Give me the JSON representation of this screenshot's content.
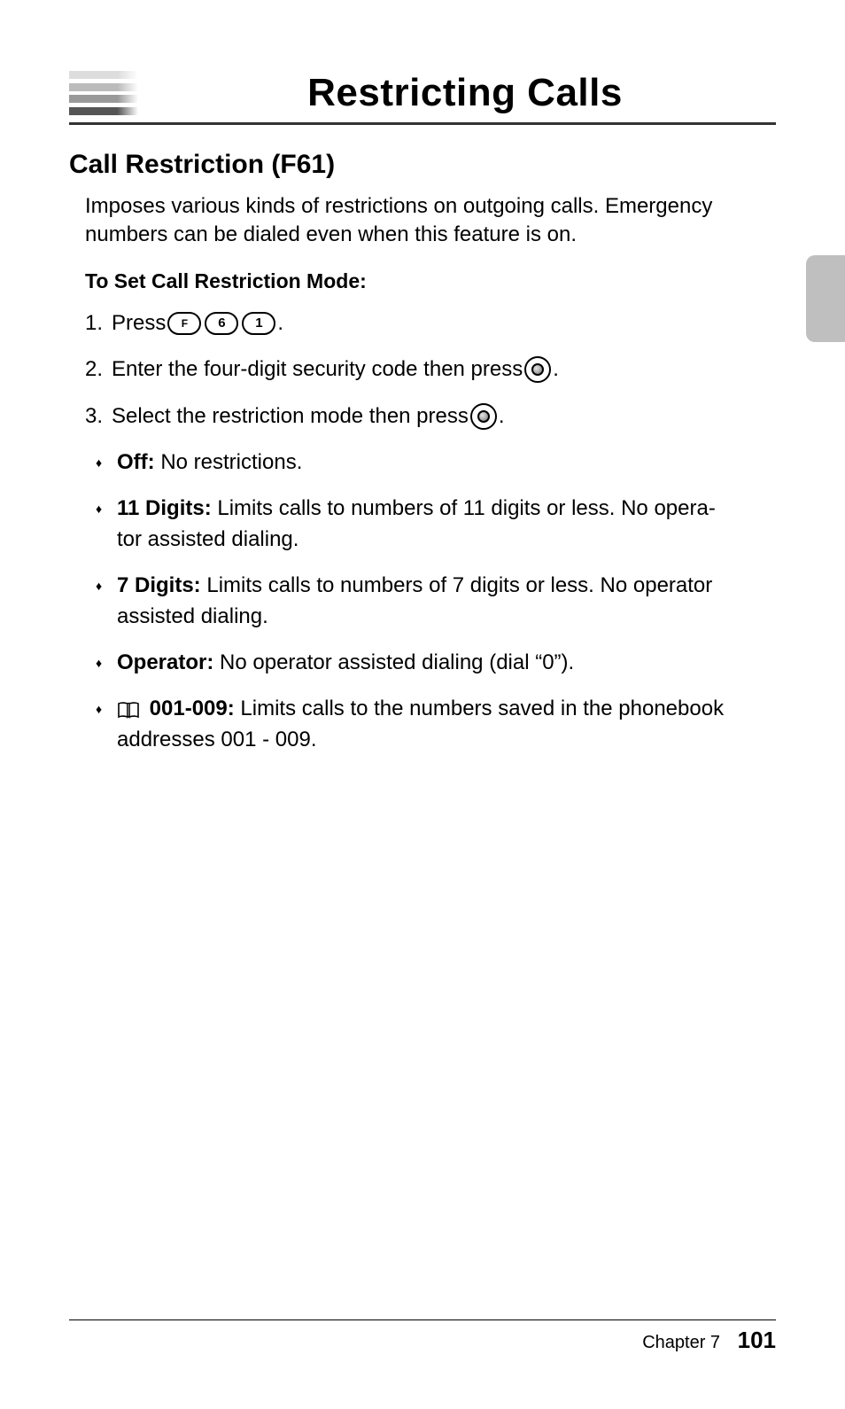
{
  "header": {
    "title": "Restricting Calls"
  },
  "section": {
    "heading": "Call Restriction (F61)",
    "intro": "Imposes various kinds of restrictions on outgoing calls. Emergency numbers can be dialed even when this feature is on.",
    "subheading": "To Set Call Restriction Mode:"
  },
  "steps": {
    "s1": {
      "num": "1.",
      "a": "Press ",
      "k1": "F",
      "k2": "6",
      "k3": "1",
      "b": "."
    },
    "s2": {
      "num": "2.",
      "a": "Enter the four-digit security code then press ",
      "b": "."
    },
    "s3": {
      "num": "3.",
      "a": "Select the restriction mode then press ",
      "b": "."
    }
  },
  "bullets": {
    "b1": {
      "label": "Off:",
      "text": " No restrictions."
    },
    "b2": {
      "label": "11 Digits:",
      "text": " Limits calls to numbers of 11 digits or less. No opera-",
      "cont": "tor assisted dialing."
    },
    "b3": {
      "label": "7 Digits:",
      "text": " Limits calls to numbers of 7 digits or less. No operator",
      "cont": "assisted dialing."
    },
    "b4": {
      "label": "Operator:",
      "text": " No operator assisted dialing (dial “0”)."
    },
    "b5": {
      "label": " 001-009:",
      "text": " Limits calls to the numbers saved in the phonebook",
      "cont": "addresses 001 - 009."
    }
  },
  "footer": {
    "chapter": "Chapter 7",
    "page": "101"
  }
}
